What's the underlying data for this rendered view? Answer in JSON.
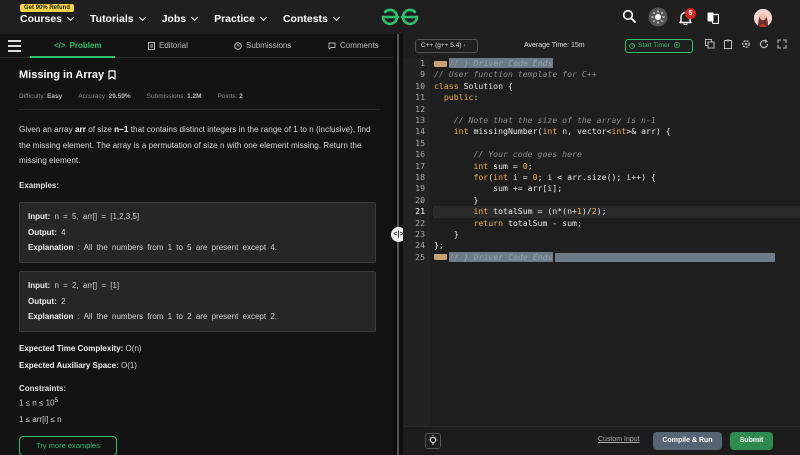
{
  "topnav": {
    "promo": "Get 90% Refund",
    "menu": [
      "Courses",
      "Tutorials",
      "Jobs",
      "Practice",
      "Contests"
    ],
    "notification_count": "5"
  },
  "tabs": {
    "problem": "Problem",
    "editorial": "Editorial",
    "submissions": "Submissions",
    "comments": "Comments"
  },
  "problem": {
    "title": "Missing in Array",
    "difficulty_label": "Difficulty:",
    "difficulty": "Easy",
    "accuracy_label": "Accuracy:",
    "accuracy": "29.59%",
    "submissions_label": "Submissions:",
    "submissions": "1.2M",
    "points_label": "Points:",
    "points": "2",
    "desc_1": "Given an array ",
    "desc_arr": "arr",
    "desc_2": " of size ",
    "desc_n1": "n−1",
    "desc_3": " that contains distinct integers in the range of 1 to n (inclusive), find the missing element. The array is a permutation of size n with one element missing. Return the missing element.",
    "examples_heading": "Examples:",
    "examples": [
      {
        "input_label": "Input:",
        "input": " n = 5, arr[] = [1,2,3,5]",
        "output_label": "Output:",
        "output": " 4",
        "explanation_label": "Explanation",
        "explanation": " : All the numbers from 1 to 5 are present except 4."
      },
      {
        "input_label": "Input:",
        "input": " n = 2, arr[] = [1]",
        "output_label": "Output:",
        "output": " 2",
        "explanation_label": "Explanation",
        "explanation": " : All the numbers from 1 to 2 are present except 2."
      }
    ],
    "time_label": "Expected Time Complexity:",
    "time": " O(n)",
    "space_label": "Expected Auxiliary Space:",
    "space": " O(1)",
    "constraints_heading": "Constraints:",
    "constraint_1_base": "1 ≤ n ≤ 10",
    "constraint_1_exp": "5",
    "constraint_2": "1 ≤ arr[i] ≤ n",
    "more_examples": "Try more examples"
  },
  "editor": {
    "language": "C++ (g++ 5.4)",
    "avg_time": "Average Time: 15m",
    "start_timer": "Start Timer",
    "line_numbers": [
      "1",
      "9",
      "10",
      "11",
      "12",
      "13",
      "14",
      "15",
      "16",
      "17",
      "18",
      "19",
      "20",
      "21",
      "22",
      "23",
      "24",
      "25"
    ],
    "l1": "// } Driver Code Ends",
    "l9": "// User function template for C++",
    "l10_kw": "class",
    "l10_rest": " Solution {",
    "l11_kw": "public",
    "l11_rest": ":",
    "l13": "// Note that the size of the array is n-1",
    "l14_t": "int",
    "l14_a": " missingNumber(",
    "l14_b": "int",
    "l14_c": " n, vector<",
    "l14_d": "int",
    "l14_e": ">& arr) {",
    "l16": "// Your code goes here",
    "l17_t": "int",
    "l17_a": " sum = ",
    "l17_n": "0",
    "l17_b": ";",
    "l18_kw": "for",
    "l18_a": "(",
    "l18_t": "int",
    "l18_b": " i = ",
    "l18_n": "0",
    "l18_c": "; i < arr.size(); i++) {",
    "l19": "sum += arr[i];",
    "l20": "}",
    "l21_t": "int",
    "l21_a": " totalSum = (n*(n+",
    "l21_n1": "1",
    "l21_b": ")/",
    "l21_n2": "2",
    "l21_c": ");",
    "l22_kw": "return",
    "l22_rest": " totalSum - sum;",
    "l23": "}",
    "l24": "};",
    "l25": "// } Driver Code Ends"
  },
  "footer": {
    "custom_input": "Custom Input",
    "compile_run": "Compile & Run",
    "submit": "Submit"
  },
  "colors": {
    "accent_green": "#2fbf6e",
    "keyword": "#f5b04a",
    "comment": "#8c8c8c"
  }
}
